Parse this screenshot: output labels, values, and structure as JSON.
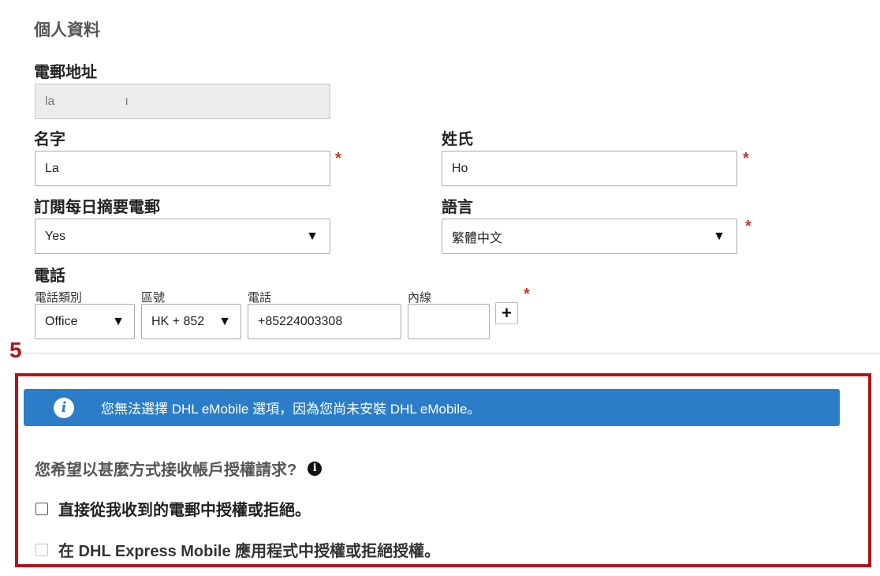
{
  "section_title": "個人資料",
  "email": {
    "label": "電郵地址",
    "value": "la                    ı"
  },
  "first_name": {
    "label": "名字",
    "value": "La"
  },
  "last_name": {
    "label": "姓氏",
    "value": "Ho"
  },
  "digest": {
    "label": "訂閱每日摘要電郵",
    "value": "Yes"
  },
  "language": {
    "label": "語言",
    "value": "繁體中文"
  },
  "phone": {
    "label": "電話",
    "type_label": "電話類別",
    "type_value": "Office",
    "code_label": "區號",
    "code_value": "HK + 852",
    "number_label": "電話",
    "number_value": "+85224003308",
    "ext_label": "內線",
    "ext_value": "",
    "add_label": "+"
  },
  "required_mark": "*",
  "step_number": "5",
  "info_banner": {
    "icon": "info-icon",
    "text": "您無法選擇 DHL eMobile 選項，因為您尚未安裝 DHL eMobile。"
  },
  "auth_question": "您希望以甚麼方式接收帳戶授權請求?",
  "help_icon_glyph": "i",
  "options": [
    {
      "label": "直接從我收到的電郵中授權或拒絕。",
      "checked": false,
      "disabled": false
    },
    {
      "label": "在 DHL Express Mobile 應用程式中授權或拒絕授權。",
      "checked": false,
      "disabled": true
    }
  ],
  "colors": {
    "accent_red": "#b3121a",
    "info_blue": "#2c7dc7",
    "required_red": "#c0392b"
  }
}
